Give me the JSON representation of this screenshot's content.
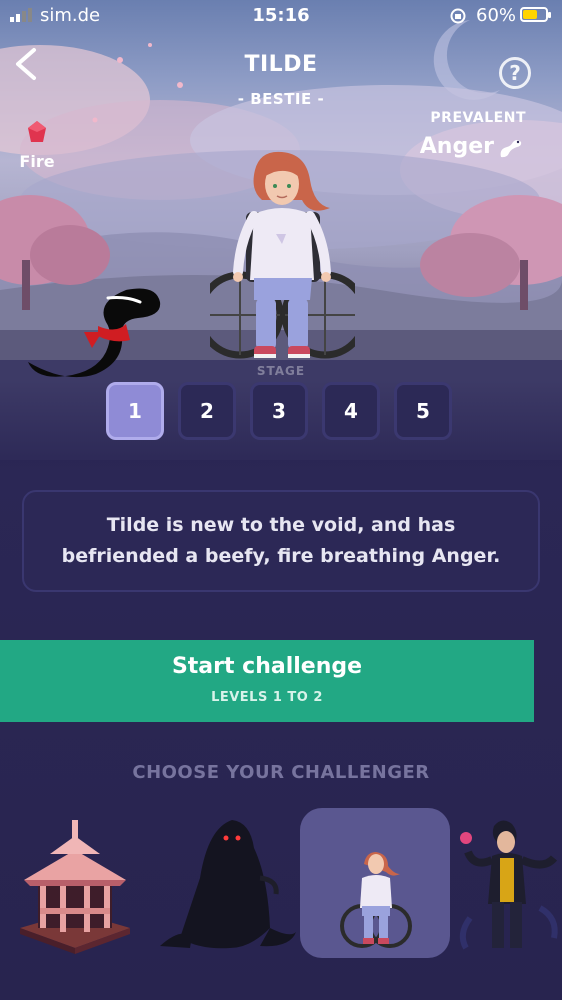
{
  "status_bar": {
    "carrier": "sim.de",
    "time": "15:16",
    "battery": "60%"
  },
  "character": {
    "name": "TILDE",
    "subtitle": "- BESTIE -"
  },
  "element": {
    "label": "Fire",
    "icon": "fire-gem-icon",
    "color": "#e0344f"
  },
  "prevalent": {
    "label": "PREVALENT",
    "value": "Anger",
    "icon": "anger-serpent-icon"
  },
  "stage": {
    "label": "STAGE",
    "options": [
      "1",
      "2",
      "3",
      "4",
      "5"
    ],
    "selected": "1"
  },
  "description": "Tilde is new to the void, and has befriended a beefy, fire breathing Anger.",
  "start": {
    "label": "Start challenge",
    "sublabel": "LEVELS 1 TO 2",
    "color": "#22a884"
  },
  "challengers": {
    "heading": "CHOOSE YOUR CHALLENGER",
    "items": [
      {
        "name": "gazebo",
        "selected": false
      },
      {
        "name": "hooded-figure",
        "selected": false
      },
      {
        "name": "tilde",
        "selected": true
      },
      {
        "name": "clawed-fighter",
        "selected": false
      }
    ]
  },
  "colors": {
    "background": "#27234d",
    "stage_active": "#8f8bd6",
    "heading_muted": "#77749e"
  }
}
